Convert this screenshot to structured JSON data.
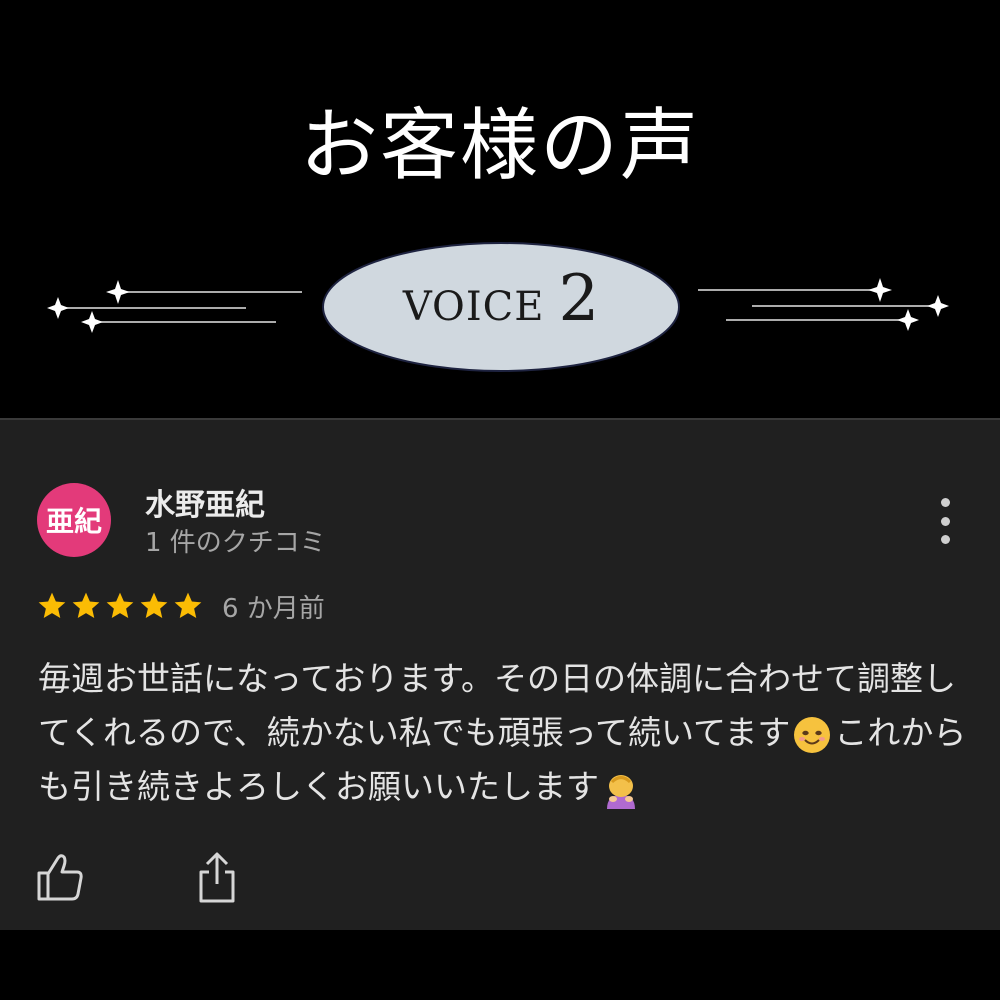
{
  "banner": {
    "title": "お客様の声",
    "voice_label": "VOICE",
    "voice_number": "2"
  },
  "review": {
    "avatar_text": "亜紀",
    "avatar_color": "#e33a7a",
    "reviewer_name": "水野亜紀",
    "review_count": "1 件のクチコミ",
    "rating": 5,
    "rating_max": 5,
    "star_color": "#fbbc04",
    "posted_time": "6 か月前",
    "body_part1": "毎週お世話になっております。その日の体調に合わせて調整してくれるので、続かない私でも頑張って続いてます",
    "emoji1": "smiling-face-emoji",
    "body_part2": "これからも引き続きよろしくお願いいたします",
    "emoji2": "person-bowing-emoji"
  },
  "actions": {
    "like_icon": "thumbs-up-icon",
    "share_icon": "share-icon",
    "more_icon": "more-vertical-icon"
  }
}
